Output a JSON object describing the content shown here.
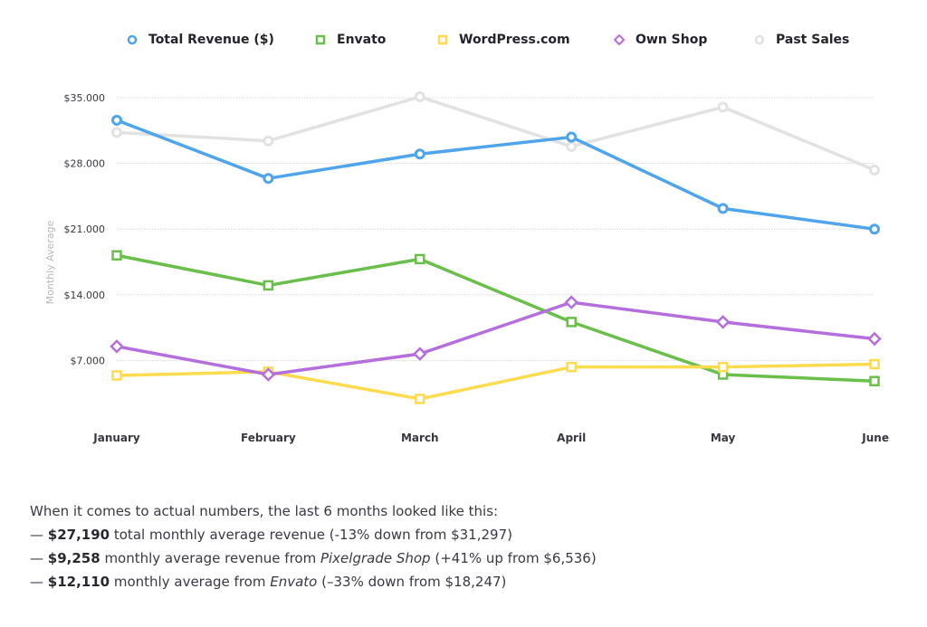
{
  "chart_data": {
    "type": "line",
    "title": "",
    "xlabel": "",
    "ylabel": "Monthly Average",
    "categories": [
      "January",
      "February",
      "March",
      "April",
      "May",
      "June"
    ],
    "ylim": [
      0,
      35000
    ],
    "y_ticks": [
      7000,
      14000,
      21000,
      28000,
      35000
    ],
    "y_tick_labels": [
      "$7.000",
      "$14.000",
      "$21.000",
      "$28.000",
      "$35.000"
    ],
    "grid": true,
    "legend_position": "top",
    "series": [
      {
        "name": "Total Revenue ($)",
        "color": "#4ea5ec",
        "marker": "circle",
        "values": [
          32600,
          26400,
          29000,
          30800,
          23200,
          21000
        ]
      },
      {
        "name": "Envato",
        "color": "#69bf4a",
        "marker": "square",
        "values": [
          18200,
          15000,
          17800,
          11100,
          5500,
          4800
        ]
      },
      {
        "name": "WordPress.com",
        "color": "#fddb4e",
        "marker": "square",
        "values": [
          5400,
          5800,
          2900,
          6300,
          6300,
          6600
        ]
      },
      {
        "name": "Own Shop",
        "color": "#b46ede",
        "marker": "diamond",
        "values": [
          8500,
          5500,
          7700,
          13200,
          11100,
          9300
        ]
      },
      {
        "name": "Past Sales",
        "color": "#e2e2e2",
        "marker": "circle",
        "values": [
          31300,
          30400,
          35100,
          29800,
          34000,
          27300
        ]
      }
    ]
  },
  "summary": {
    "intro": "When it comes to actual numbers, the last 6 months looked like this:",
    "lines": [
      {
        "dash": "—",
        "bold": "$27,190",
        "text1": " total monthly average revenue (-13% down from $31,297)",
        "italic": "",
        "text2": ""
      },
      {
        "dash": "—",
        "bold": "$9,258",
        "text1": " monthly average revenue from ",
        "italic": "Pixelgrade Shop",
        "text2": " (+41% up from $6,536)"
      },
      {
        "dash": "—",
        "bold": "$12,110",
        "text1": " monthly average from ",
        "italic": "Envato",
        "text2": " (–33% down from $18,247)"
      }
    ]
  }
}
